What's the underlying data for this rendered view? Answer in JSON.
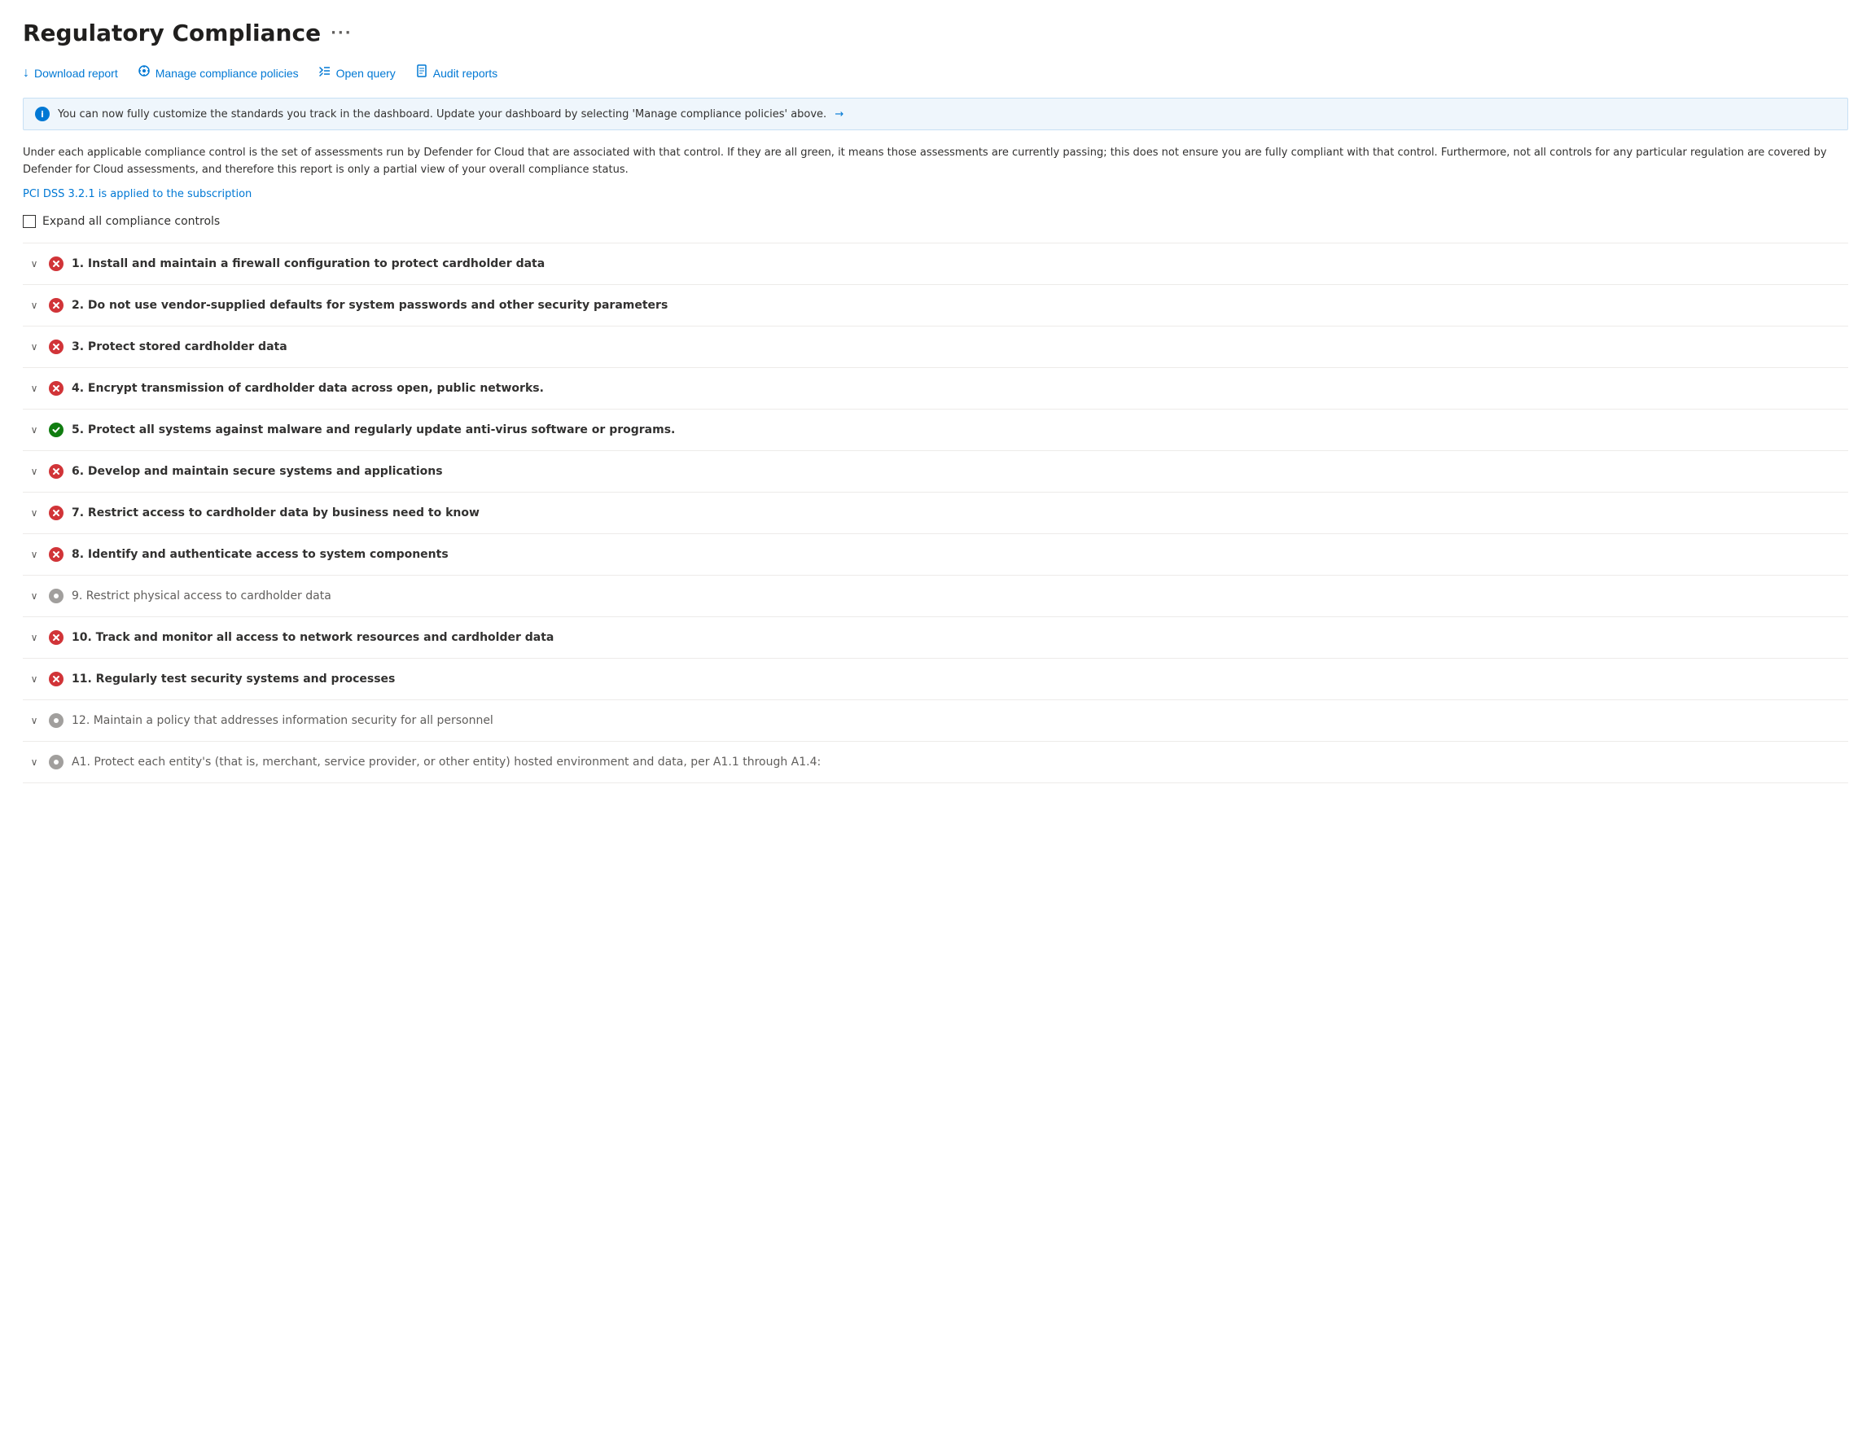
{
  "page": {
    "title": "Regulatory Compliance",
    "more_icon": "···"
  },
  "toolbar": {
    "buttons": [
      {
        "id": "download-report",
        "label": "Download report",
        "icon": "↓"
      },
      {
        "id": "manage-policies",
        "label": "Manage compliance policies",
        "icon": "⊙"
      },
      {
        "id": "open-query",
        "label": "Open query",
        "icon": "⟨⟩"
      },
      {
        "id": "audit-reports",
        "label": "Audit reports",
        "icon": "📋"
      }
    ]
  },
  "info_banner": {
    "text": "You can now fully customize the standards you track in the dashboard. Update your dashboard by selecting 'Manage compliance policies' above.",
    "arrow": "→"
  },
  "description": "Under each applicable compliance control is the set of assessments run by Defender for Cloud that are associated with that control. If they are all green, it means those assessments are currently passing; this does not ensure you are fully compliant with that control. Furthermore, not all controls for any particular regulation are covered by Defender for Cloud assessments, and therefore this report is only a partial view of your overall compliance status.",
  "subscription_link": "PCI DSS 3.2.1 is applied to the subscription",
  "expand_label": "Expand all compliance controls",
  "compliance_items": [
    {
      "id": "item-1",
      "status": "error",
      "label": "1. Install and maintain a firewall configuration to protect cardholder data",
      "dimmed": false
    },
    {
      "id": "item-2",
      "status": "error",
      "label": "2. Do not use vendor-supplied defaults for system passwords and other security parameters",
      "dimmed": false
    },
    {
      "id": "item-3",
      "status": "error",
      "label": "3. Protect stored cardholder data",
      "dimmed": false
    },
    {
      "id": "item-4",
      "status": "error",
      "label": "4. Encrypt transmission of cardholder data across open, public networks.",
      "dimmed": false
    },
    {
      "id": "item-5",
      "status": "success",
      "label": "5. Protect all systems against malware and regularly update anti-virus software or programs.",
      "dimmed": false
    },
    {
      "id": "item-6",
      "status": "error",
      "label": "6. Develop and maintain secure systems and applications",
      "dimmed": false
    },
    {
      "id": "item-7",
      "status": "error",
      "label": "7. Restrict access to cardholder data by business need to know",
      "dimmed": false
    },
    {
      "id": "item-8",
      "status": "error",
      "label": "8. Identify and authenticate access to system components",
      "dimmed": false
    },
    {
      "id": "item-9",
      "status": "neutral",
      "label": "9. Restrict physical access to cardholder data",
      "dimmed": true
    },
    {
      "id": "item-10",
      "status": "error",
      "label": "10. Track and monitor all access to network resources and cardholder data",
      "dimmed": false
    },
    {
      "id": "item-11",
      "status": "error",
      "label": "11. Regularly test security systems and processes",
      "dimmed": false
    },
    {
      "id": "item-12",
      "status": "neutral",
      "label": "12. Maintain a policy that addresses information security for all personnel",
      "dimmed": true
    },
    {
      "id": "item-a1",
      "status": "neutral",
      "label": "A1. Protect each entity's (that is, merchant, service provider, or other entity) hosted environment and data, per A1.1 through A1.4:",
      "dimmed": true
    }
  ],
  "status_icons": {
    "error_char": "✕",
    "success_char": "✓",
    "neutral_char": "●"
  }
}
